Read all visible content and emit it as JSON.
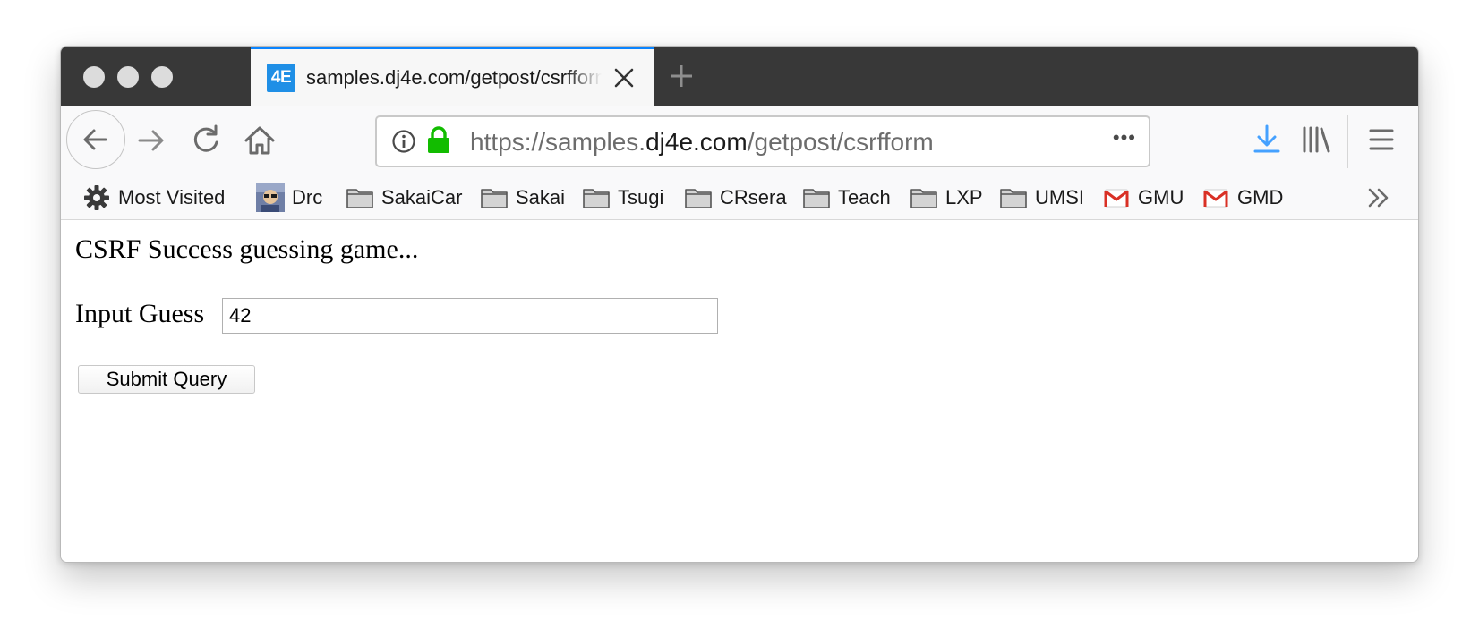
{
  "tab": {
    "favicon_text": "4E",
    "title": "samples.dj4e.com/getpost/csrfform"
  },
  "url": {
    "prefix": "https://samples.",
    "domain": "dj4e.com",
    "path": "/getpost/csrfform",
    "more_label": "•••"
  },
  "bookmarks": [
    {
      "label": "Most Visited",
      "icon": "gear-icon"
    },
    {
      "label": "Drc",
      "icon": "avatar-icon"
    },
    {
      "label": "SakaiCar",
      "icon": "folder-icon"
    },
    {
      "label": "Sakai",
      "icon": "folder-icon"
    },
    {
      "label": "Tsugi",
      "icon": "folder-icon"
    },
    {
      "label": "CRsera",
      "icon": "folder-icon"
    },
    {
      "label": "Teach",
      "icon": "folder-icon"
    },
    {
      "label": "LXP",
      "icon": "folder-icon"
    },
    {
      "label": "UMSI",
      "icon": "folder-icon"
    },
    {
      "label": "GMU",
      "icon": "gmail-icon"
    },
    {
      "label": "GMD",
      "icon": "gmail-icon"
    }
  ],
  "page": {
    "heading": "CSRF Success guessing game...",
    "input_label": "Input Guess",
    "input_value": "42",
    "submit_label": "Submit Query"
  },
  "colors": {
    "tabstrip": "#383838",
    "accent": "#0a84ff",
    "download": "#45a1ff",
    "lock": "#12bc00",
    "gmail": "#d93025"
  }
}
